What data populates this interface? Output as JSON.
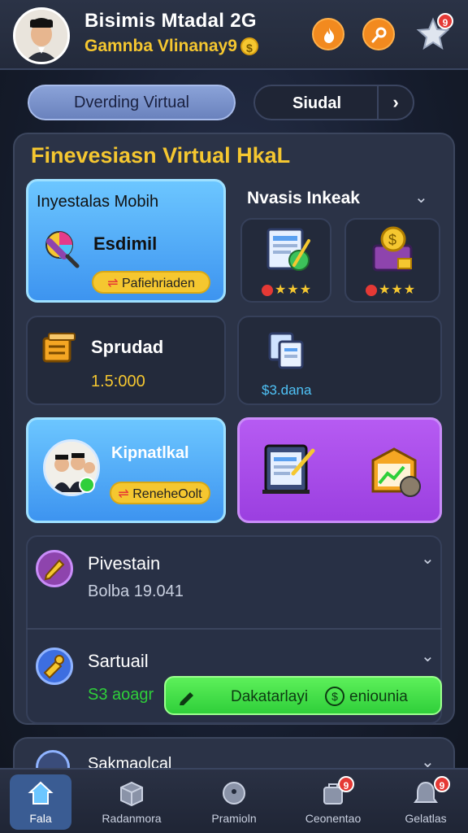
{
  "header": {
    "title": "Bisimis Mtadal 2G",
    "subtitle": "Gamnba Vlinanay9",
    "coin_symbol": "$",
    "notification_count": "9"
  },
  "tabs": {
    "left_label": "Dverding Virtual",
    "right_label": "Siudal",
    "right_arrow": "›"
  },
  "panel": {
    "title": "Finevesiasn Virtual HkaL",
    "cards": {
      "investasi": {
        "title": "Inyestalas Mobih",
        "label": "Esdimil",
        "pill": "Pafiehriaden"
      },
      "nvasis": {
        "title": "Nvasis Inkeak",
        "chevron": "⌄"
      },
      "spruded": {
        "title": "Sprudad",
        "value": "1.5:000"
      },
      "docs": {
        "value": "$3.dana"
      },
      "kiprat": {
        "title": "Kipnatlkal",
        "pill": "ReneheOolt"
      }
    },
    "rows": [
      {
        "title": "Pivestain",
        "sub": "Bolba 19.041",
        "chevron": "⌄"
      },
      {
        "title": "Sartuail",
        "sub": "S3 aoagr",
        "chevron": "⌄"
      }
    ],
    "green_button": "Dakatarlayi",
    "green_button_suffix": "eniounia"
  },
  "peek": {
    "title": "Sakmaolcal"
  },
  "nav": [
    {
      "label": "Fala",
      "active": true
    },
    {
      "label": "Radanmora"
    },
    {
      "label": "Pramioln"
    },
    {
      "label": "Ceonentao",
      "badge": "9"
    },
    {
      "label": "Gelatlas",
      "badge": "9"
    }
  ],
  "colors": {
    "accent_gold": "#f5c730",
    "accent_orange": "#f28a1f",
    "green": "#2fcf3a",
    "purple": "#9b3fe0",
    "blue": "#3d94f0"
  }
}
